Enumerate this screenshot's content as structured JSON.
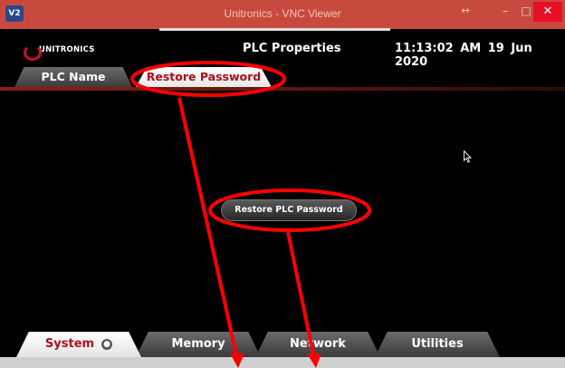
{
  "window": {
    "app_icon": "V2",
    "title": "Unitronics - VNC Viewer",
    "buttons": {
      "resize": "↔",
      "minimize": "–",
      "maximize": "□",
      "close": "✕"
    }
  },
  "header": {
    "logo_text": "UNITRONICS",
    "title": "PLC Properties",
    "time": "11:13:02 AM",
    "date": "19 Jun 2020"
  },
  "top_tabs": [
    {
      "label": "PLC Name",
      "active": false
    },
    {
      "label": "Restore Password",
      "active": true
    }
  ],
  "main": {
    "restore_button_label": "Restore PLC Password"
  },
  "bottom_tabs": [
    {
      "label": "System",
      "active": true
    },
    {
      "label": "Memory",
      "active": false
    },
    {
      "label": "Network",
      "active": false
    },
    {
      "label": "Utilities",
      "active": false
    }
  ],
  "colors": {
    "titlebar": "#c84a3e",
    "accent_red": "#c8102e",
    "annotation": "#ff0000",
    "close_button": "#e81123"
  },
  "icons": [
    "vnc-app-icon",
    "resize-icon",
    "minimize-icon",
    "maximize-icon",
    "close-icon",
    "unitronics-logo-icon",
    "mouse-cursor-icon",
    "system-dot-icon"
  ]
}
